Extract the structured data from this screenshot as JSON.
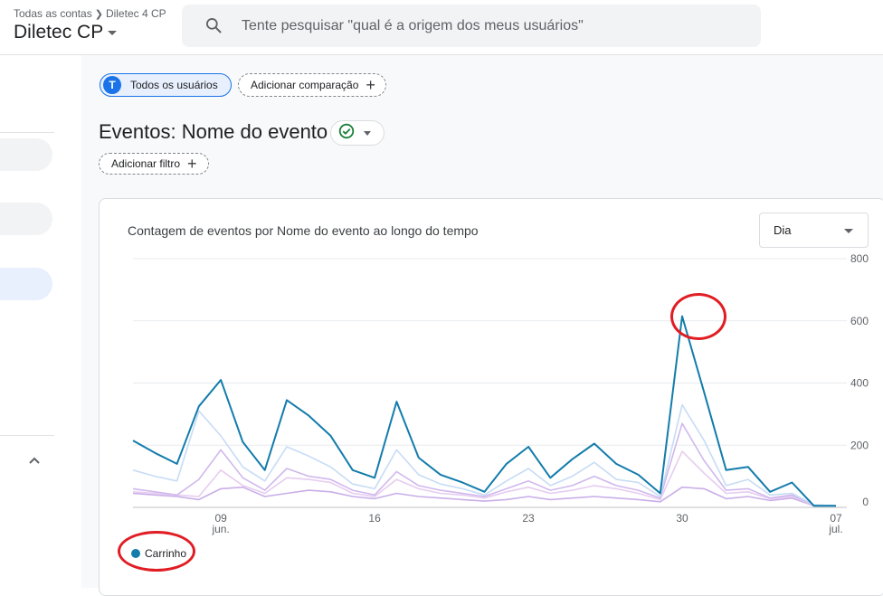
{
  "header": {
    "breadcrumb": [
      "Todas as contas",
      "Diletec 4 CP"
    ],
    "property": "Diletec CP",
    "search": {
      "placeholder": "Tente pesquisar \"qual é a origem dos meus usuários\"",
      "icon": "search-icon"
    }
  },
  "filters": {
    "segment": {
      "avatar": "T",
      "label": "Todos os usuários"
    },
    "compare_label": "Adicionar comparação",
    "add_filter_label": "Adicionar filtro"
  },
  "page": {
    "title": "Eventos: Nome do evento"
  },
  "chart_card": {
    "title": "Contagem de eventos por Nome do evento ao longo do tempo",
    "granularity": "Dia"
  },
  "colors": {
    "primary": "#1a73e8",
    "series_main": "#137cab",
    "annotation": "#e11d24"
  },
  "chart_data": {
    "type": "line",
    "x": [
      "05/06",
      "06/06",
      "07/06",
      "08/06",
      "09/06",
      "10/06",
      "11/06",
      "12/06",
      "13/06",
      "14/06",
      "15/06",
      "16/06",
      "17/06",
      "18/06",
      "19/06",
      "20/06",
      "21/06",
      "22/06",
      "23/06",
      "24/06",
      "25/06",
      "26/06",
      "27/06",
      "28/06",
      "29/06",
      "30/06",
      "01/07",
      "02/07",
      "03/07",
      "04/07",
      "05/07",
      "06/07",
      "07/07"
    ],
    "x_ticks": [
      {
        "label": "09",
        "sublabel": "jun.",
        "index": 4
      },
      {
        "label": "16",
        "sublabel": "",
        "index": 11
      },
      {
        "label": "23",
        "sublabel": "",
        "index": 18
      },
      {
        "label": "30",
        "sublabel": "",
        "index": 25
      },
      {
        "label": "07",
        "sublabel": "jul.",
        "index": 32
      }
    ],
    "yticks": [
      0,
      200,
      400,
      600,
      800
    ],
    "ylim": [
      0,
      800
    ],
    "series": [
      {
        "name": "Carrinho",
        "color": "#137cab",
        "values": [
          215,
          175,
          140,
          325,
          410,
          210,
          120,
          345,
          295,
          230,
          120,
          95,
          340,
          160,
          105,
          80,
          50,
          140,
          195,
          95,
          155,
          205,
          140,
          105,
          45,
          615,
          370,
          120,
          130,
          50,
          80,
          5,
          5
        ]
      },
      {
        "name": "",
        "color": "#c6dcf5",
        "values": [
          120,
          100,
          85,
          310,
          230,
          130,
          85,
          195,
          165,
          130,
          75,
          60,
          185,
          105,
          75,
          60,
          40,
          85,
          125,
          70,
          100,
          145,
          90,
          80,
          35,
          330,
          215,
          70,
          90,
          40,
          45,
          8,
          5
        ]
      },
      {
        "name": "",
        "color": "#d0b8ed",
        "values": [
          60,
          50,
          40,
          90,
          185,
          95,
          55,
          125,
          100,
          90,
          55,
          40,
          115,
          70,
          55,
          45,
          35,
          60,
          85,
          55,
          70,
          100,
          70,
          55,
          30,
          270,
          150,
          55,
          60,
          30,
          40,
          8,
          5
        ]
      },
      {
        "name": "",
        "color": "#e6ccf0",
        "values": [
          50,
          45,
          40,
          35,
          120,
          70,
          45,
          95,
          90,
          80,
          45,
          35,
          90,
          60,
          45,
          40,
          30,
          50,
          65,
          45,
          55,
          70,
          60,
          45,
          25,
          180,
          110,
          45,
          50,
          28,
          35,
          6,
          5
        ]
      },
      {
        "name": "",
        "color": "#c9aee8",
        "values": [
          45,
          40,
          35,
          25,
          60,
          65,
          35,
          45,
          55,
          50,
          35,
          28,
          45,
          35,
          30,
          25,
          20,
          25,
          35,
          25,
          30,
          35,
          30,
          25,
          18,
          65,
          60,
          28,
          35,
          22,
          30,
          5,
          5
        ]
      }
    ]
  }
}
